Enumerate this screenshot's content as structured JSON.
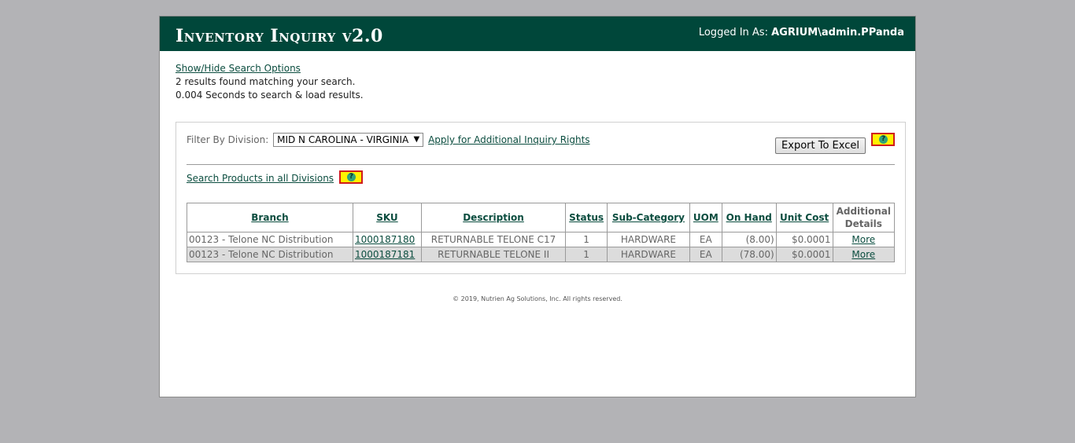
{
  "header": {
    "title": "Inventory Inquiry v2.0",
    "login_prefix": "Logged In As:",
    "login_user": "AGRIUM\\admin.PPanda"
  },
  "info": {
    "toggle_link": "Show/Hide Search Options",
    "results_text": "2 results found matching your search.",
    "timing_text": "0.004 Seconds to search & load results."
  },
  "filter": {
    "label": "Filter By Division:",
    "selected": "MID N CAROLINA - VIRGINIA",
    "apply_link": "Apply for Additional Inquiry Rights"
  },
  "export": {
    "label": "Export To Excel"
  },
  "search_all": {
    "label": "Search Products in all Divisions"
  },
  "help_icon": "?",
  "table": {
    "headers": [
      "Branch",
      "SKU",
      "Description",
      "Status",
      "Sub-Category",
      "UOM",
      "On Hand",
      "Unit Cost"
    ],
    "details_header_line1": "Additional",
    "details_header_line2": "Details",
    "rows": [
      {
        "branch": "00123 - Telone NC Distribution",
        "sku": "1000187180",
        "description": "RETURNABLE TELONE C17",
        "status": "1",
        "subcategory": "HARDWARE",
        "uom": "EA",
        "on_hand": "(8.00)",
        "unit_cost": "$0.0001",
        "details": "More"
      },
      {
        "branch": "00123 - Telone NC Distribution",
        "sku": "1000187181",
        "description": "RETURNABLE TELONE II",
        "status": "1",
        "subcategory": "HARDWARE",
        "uom": "EA",
        "on_hand": "(78.00)",
        "unit_cost": "$0.0001",
        "details": "More"
      }
    ]
  },
  "footer": {
    "text": "© 2019, Nutrien Ag Solutions, Inc. All rights reserved."
  },
  "colors": {
    "header_bg": "#00473a",
    "link": "#0b4d3f",
    "help_bg": "#fff200",
    "help_border": "#d01b1b",
    "page_bg": "#b3b3b6"
  }
}
